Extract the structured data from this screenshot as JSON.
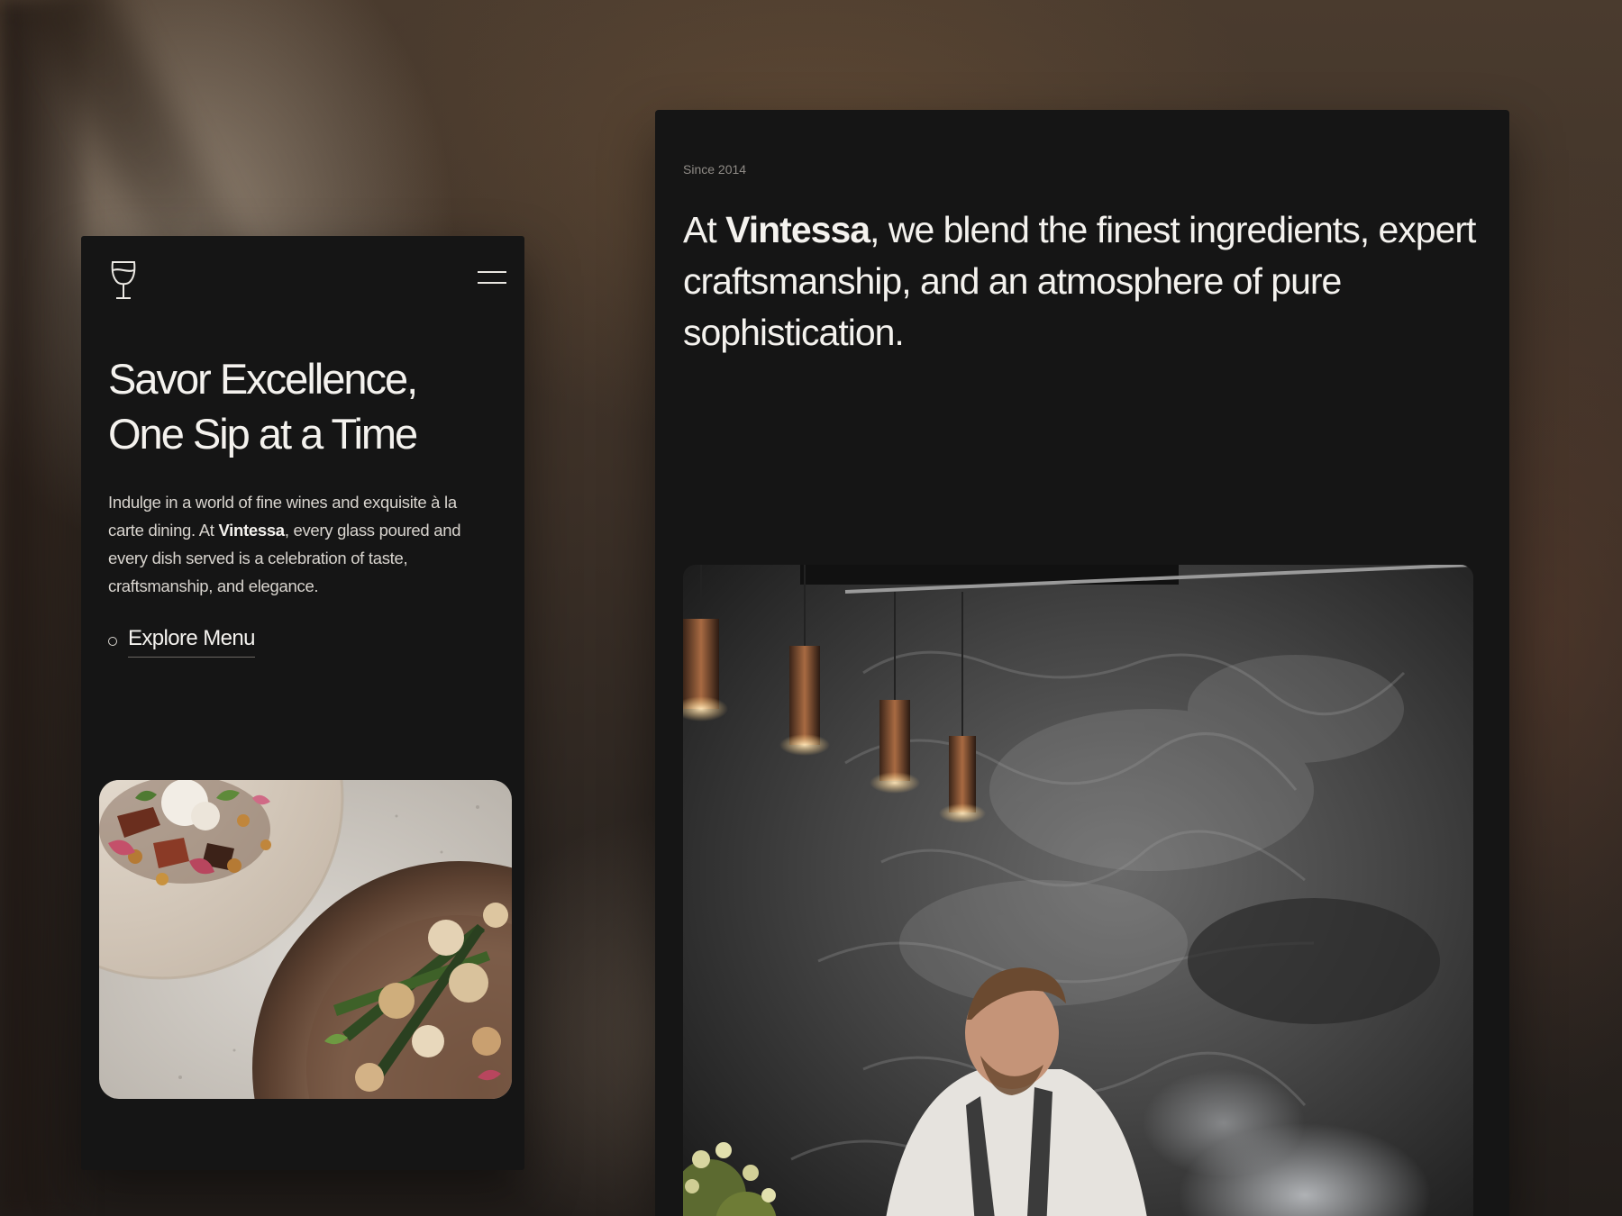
{
  "mobile": {
    "hero_title_line1": "Savor Excellence,",
    "hero_title_line2": "One Sip at a Time",
    "description_part1": "Indulge in a world of fine wines and exquisite à la carte dining. At ",
    "description_brand": "Vintessa",
    "description_part2": ", every glass poured and every dish served is a celebration of taste, craftsmanship, and elegance.",
    "cta_label": "Explore Menu",
    "icons": {
      "logo": "wine-glass-icon",
      "menu": "hamburger-menu-icon"
    }
  },
  "desktop": {
    "since": "Since 2014",
    "statement_part1": "At ",
    "statement_brand": "Vintessa",
    "statement_part2": ", we blend the finest ingredients, expert craftsmanship, and an atmosphere of pure sophistication."
  },
  "colors": {
    "card_background": "#151515",
    "text_primary": "#f4f2ee",
    "text_secondary": "#d8d4ce",
    "text_muted": "#8f8b86"
  }
}
